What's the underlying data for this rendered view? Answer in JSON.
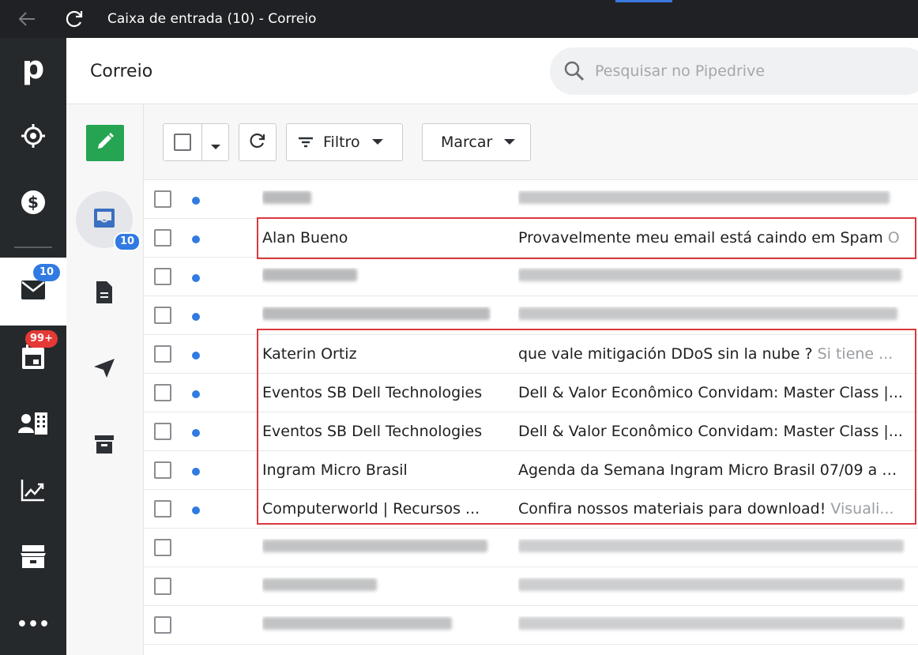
{
  "window": {
    "title": "Caixa de entrada (10) - Correio"
  },
  "rail": {
    "logo": "p",
    "mail_badge": "10",
    "calendar_badge": "99+",
    "more": "•••"
  },
  "header": {
    "title": "Correio"
  },
  "search": {
    "placeholder": "Pesquisar no Pipedrive"
  },
  "subside": {
    "inbox_badge": "10"
  },
  "toolbar": {
    "filter_label": "Filtro",
    "mark_label": "Marcar"
  },
  "colors": {
    "accent": "#317ae2",
    "compose": "#25a552",
    "badge_blue": "#317ae2",
    "badge_red": "#e53935",
    "highlight": "#d9393e"
  },
  "rows": [
    {
      "from": "",
      "subject": "",
      "preview": "",
      "unread": true
    },
    {
      "from": "Alan Bueno",
      "subject": "Provavelmente meu email está caindo em Spam",
      "preview": "O",
      "unread": true
    },
    {
      "from": "",
      "subject": "",
      "preview": "",
      "unread": true
    },
    {
      "from": "",
      "subject": "",
      "preview": "",
      "unread": true
    },
    {
      "from": "Katerin Ortiz",
      "subject": "que vale mitigación DDoS sin la nube ?",
      "preview": "Si tiene ...",
      "unread": true
    },
    {
      "from": "Eventos SB Dell Technologies",
      "subject": "Dell & Valor Econômico Convidam: Master Class |...",
      "preview": "",
      "unread": true
    },
    {
      "from": "Eventos SB Dell Technologies",
      "subject": "Dell & Valor Econômico Convidam: Master Class |...",
      "preview": "",
      "unread": true
    },
    {
      "from": "Ingram Micro Brasil",
      "subject": "Agenda da Semana Ingram Micro Brasil 07/09 a 1...",
      "preview": "",
      "unread": true
    },
    {
      "from": "Computerworld | Recursos ...",
      "subject": "Confira nossos materiais para download!",
      "preview": "Visuali...",
      "unread": true
    },
    {
      "from": "",
      "subject": "",
      "preview": "",
      "unread": false
    },
    {
      "from": "",
      "subject": "",
      "preview": "",
      "unread": false
    },
    {
      "from": "",
      "subject": "",
      "preview": "",
      "unread": false
    }
  ]
}
